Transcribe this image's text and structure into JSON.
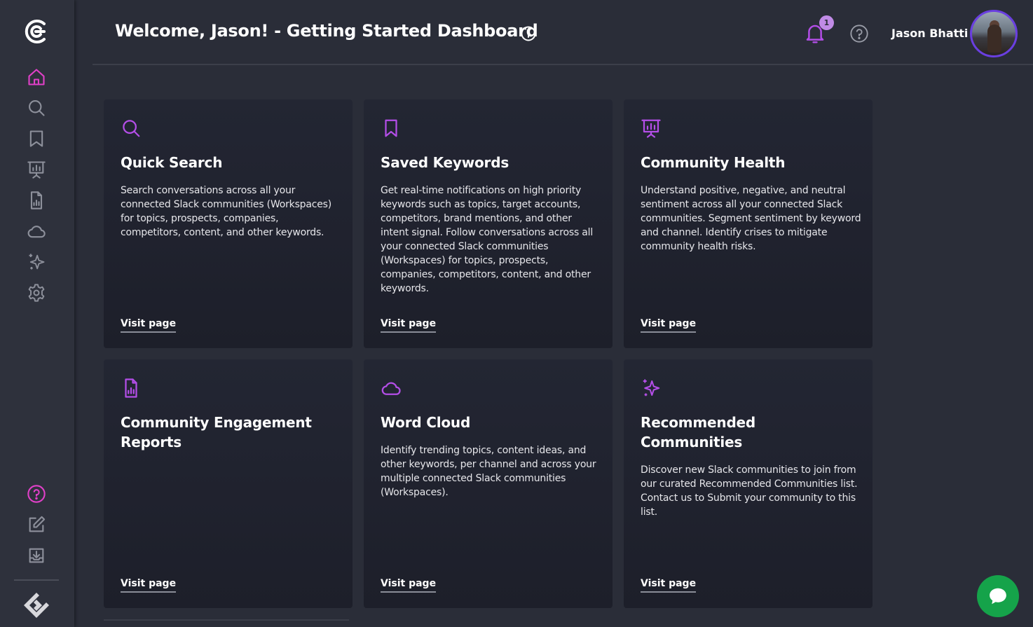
{
  "header": {
    "title": "Welcome, Jason! - Getting Started Dashboard",
    "notification_count": "1",
    "user_name": "Jason Bhatti"
  },
  "sidebar": {
    "items": [
      {
        "icon": "home-icon",
        "active": true
      },
      {
        "icon": "search-icon"
      },
      {
        "icon": "bookmark-icon"
      },
      {
        "icon": "presentation-chart-icon"
      },
      {
        "icon": "report-file-icon"
      },
      {
        "icon": "cloud-icon"
      },
      {
        "icon": "sparkles-icon"
      },
      {
        "icon": "gear-icon"
      }
    ],
    "bottom_items": [
      {
        "icon": "help-icon"
      },
      {
        "icon": "edit-icon"
      },
      {
        "icon": "download-icon"
      }
    ]
  },
  "cards": [
    {
      "icon": "search-icon",
      "title": "Quick Search",
      "description": "Search conversations across all your connected Slack communities (Workspaces) for topics, prospects, companies, competitors, content, and other keywords.",
      "link": "Visit page"
    },
    {
      "icon": "bookmark-icon",
      "title": "Saved Keywords",
      "description": "Get real-time notifications on high priority keywords such as topics, target accounts, competitors, brand mentions, and other intent signal. Follow conversations across all your connected Slack communities (Workspaces) for topics, prospects, companies, competitors, content, and other keywords.",
      "link": "Visit page"
    },
    {
      "icon": "presentation-chart-icon",
      "title": "Community Health",
      "description": "Understand positive, negative, and neutral sentiment across all your connected Slack communities. Segment sentiment by keyword and channel. Identify crises to mitigate community health risks.",
      "link": "Visit page"
    },
    {
      "icon": "report-file-icon",
      "title": "Community Engagement Reports",
      "description": "",
      "link": "Visit page"
    },
    {
      "icon": "cloud-icon",
      "title": "Word Cloud",
      "description": "Identify trending topics, content ideas, and other keywords, per channel and across your multiple connected Slack communities (Workspaces).",
      "link": "Visit page"
    },
    {
      "icon": "sparkles-icon",
      "title": "Recommended Communities",
      "description": "Discover new Slack communities to join from our curated Recommended Communities list. Contact us to Submit your community to this list.",
      "link": "Visit page"
    }
  ],
  "colors": {
    "accent": "#b44ee8",
    "active_nav": "#e040c8",
    "background": "#2a2d38",
    "card": "#1f2230",
    "chat": "#15a34a"
  }
}
